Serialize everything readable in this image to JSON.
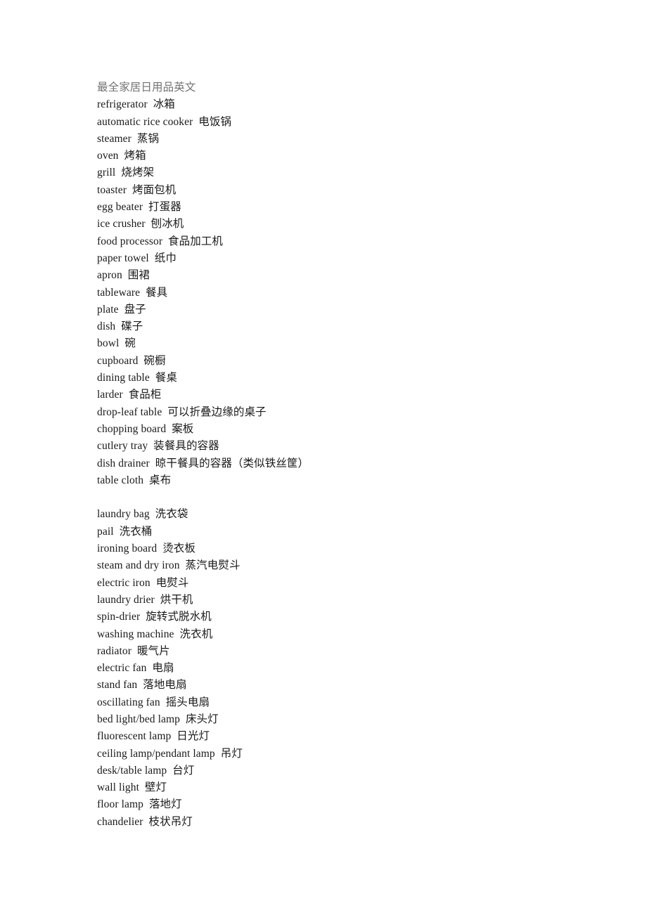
{
  "document": {
    "title": "最全家居日用品英文",
    "sections": [
      {
        "name": "kitchen-and-dining",
        "entries": [
          "refrigerator  冰箱",
          "automatic rice cooker  电饭锅",
          "steamer  蒸锅",
          "oven  烤箱",
          "grill  烧烤架",
          "toaster  烤面包机",
          "egg beater  打蛋器",
          "ice crusher  刨冰机",
          "food processor  食品加工机",
          "paper towel  纸巾",
          "apron  围裙",
          "tableware  餐具",
          "plate  盘子",
          "dish  碟子",
          "bowl  碗",
          "cupboard  碗橱",
          "dining table  餐桌",
          "larder  食品柜",
          "drop-leaf table  可以折叠边缘的桌子",
          "chopping board  案板",
          "cutlery tray  装餐具的容器",
          "dish drainer  晾干餐具的容器（类似铁丝筐）",
          "table cloth  桌布"
        ]
      },
      {
        "name": "laundry-and-lighting",
        "entries": [
          "laundry bag  洗衣袋",
          "pail  洗衣桶",
          "ironing board  烫衣板",
          "steam and dry iron  蒸汽电熨斗",
          "electric iron  电熨斗",
          "laundry drier  烘干机",
          "spin-drier  旋转式脱水机",
          "washing machine  洗衣机",
          "radiator  暖气片",
          "electric fan  电扇",
          "stand fan  落地电扇",
          "oscillating fan  摇头电扇",
          "bed light/bed lamp  床头灯",
          "fluorescent lamp  日光灯",
          "ceiling lamp/pendant lamp  吊灯",
          "desk/table lamp  台灯",
          "wall light  壁灯",
          "floor lamp  落地灯",
          "chandelier  枝状吊灯"
        ]
      }
    ]
  }
}
